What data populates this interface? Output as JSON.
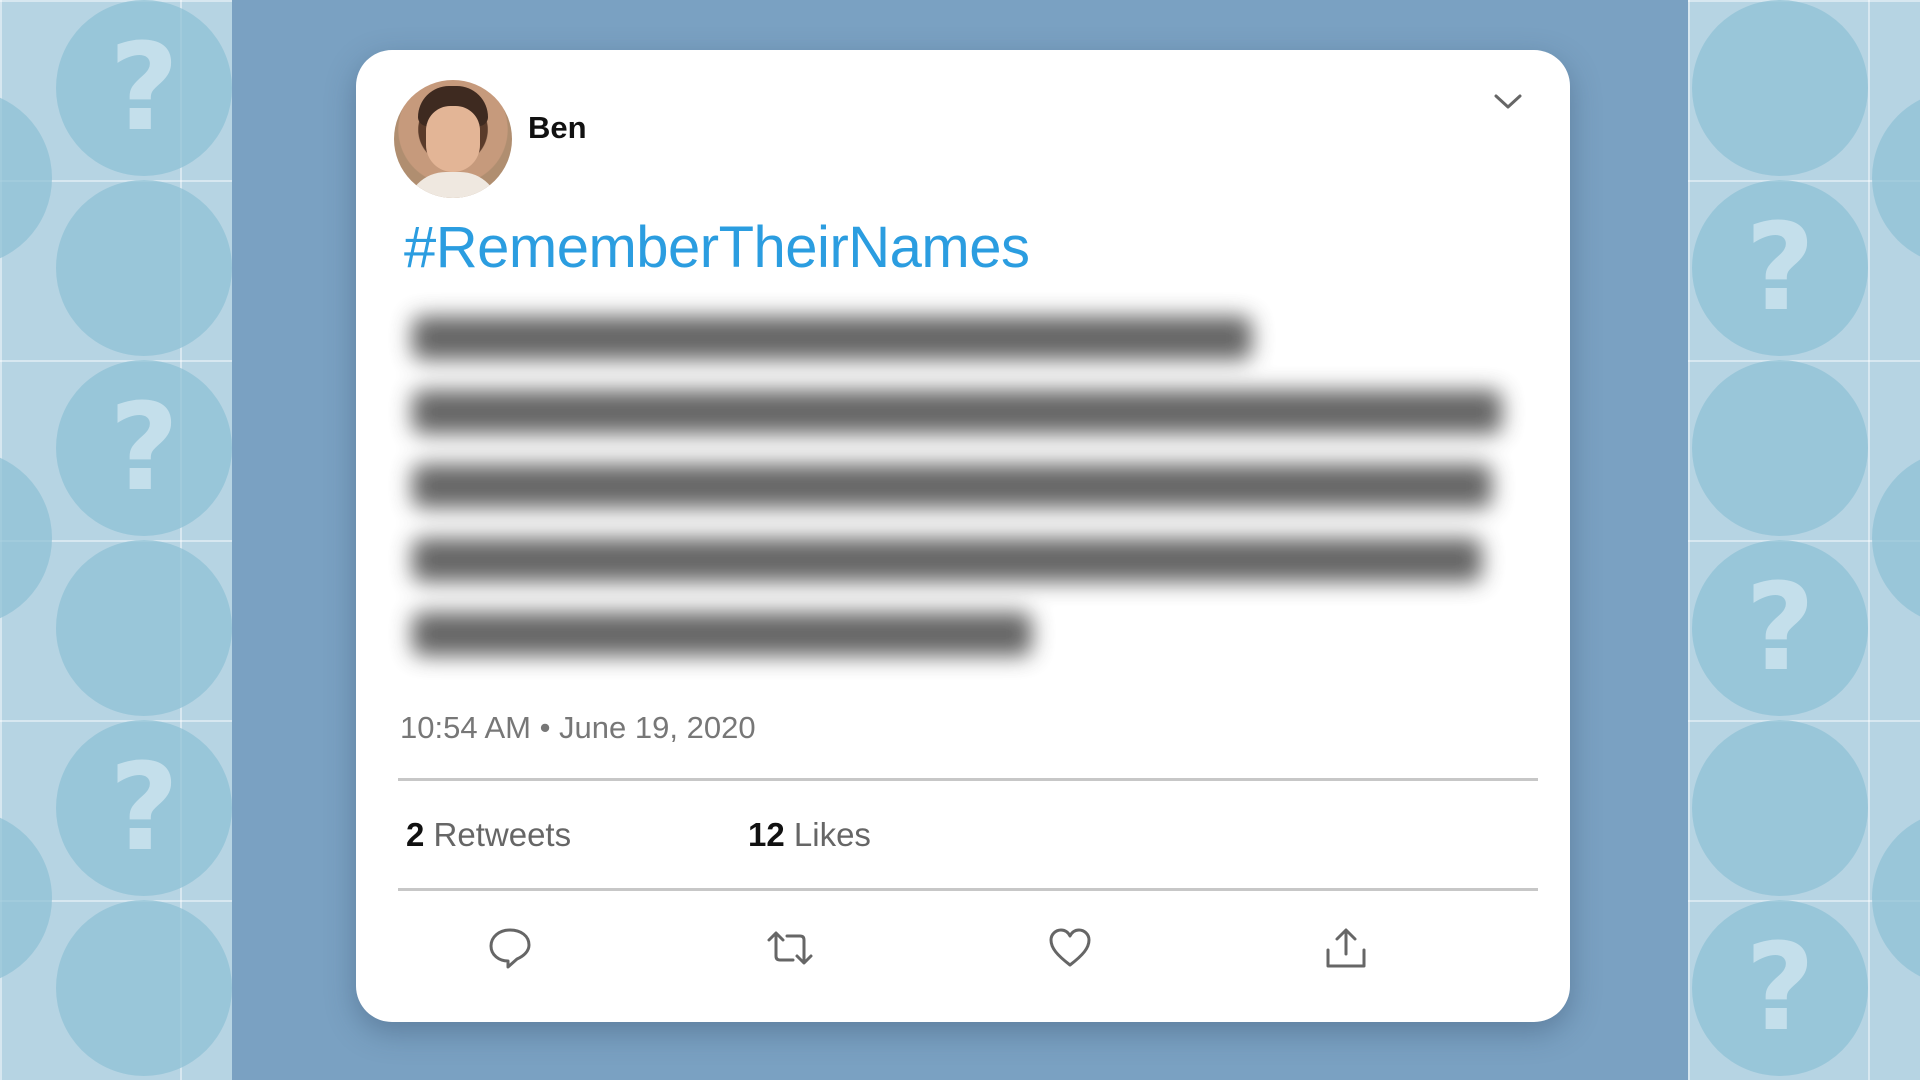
{
  "tweet": {
    "username": "Ben",
    "hashtag": "#RememberTheirNames",
    "timestamp": "10:54 AM • June 19, 2020",
    "retweets": {
      "count": "2",
      "label": "Retweets"
    },
    "likes": {
      "count": "12",
      "label": "Likes"
    },
    "actions": [
      "reply-icon",
      "retweet-icon",
      "like-icon",
      "share-icon"
    ]
  },
  "colors": {
    "hashtag": "#2b9de0",
    "background": "#7aa1c2",
    "card": "#ffffff"
  }
}
